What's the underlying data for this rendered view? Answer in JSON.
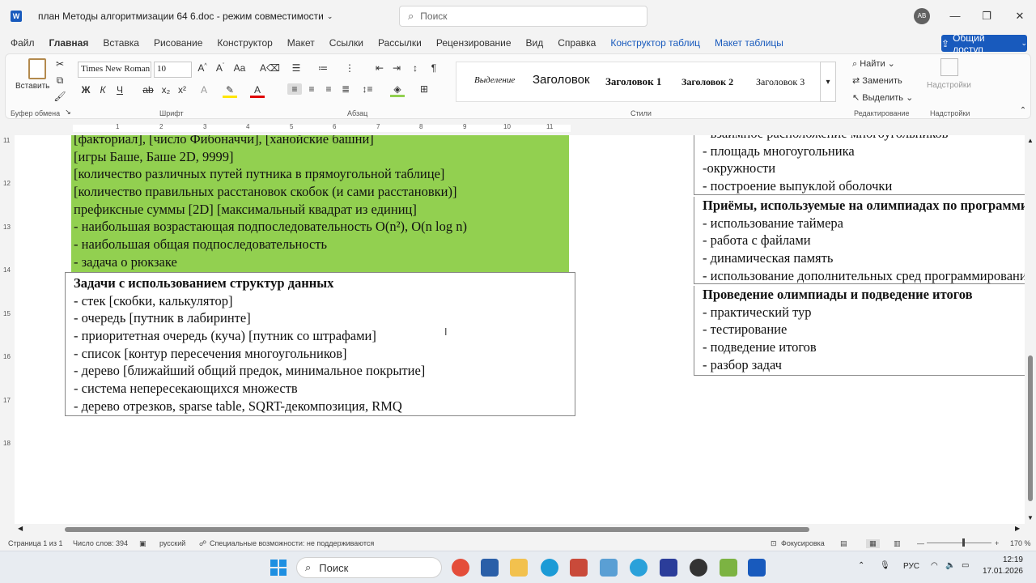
{
  "window": {
    "title": "план Методы алгоритмизации 64 6.doc  -  режим совместимости",
    "search_placeholder": "Поиск",
    "user_initials": "АВ"
  },
  "menu": [
    "Файл",
    "Главная",
    "Вставка",
    "Рисование",
    "Конструктор",
    "Макет",
    "Ссылки",
    "Рассылки",
    "Рецензирование",
    "Вид",
    "Справка",
    "Конструктор таблиц",
    "Макет таблицы"
  ],
  "share_label": "Общий доступ",
  "ribbon": {
    "paste_label": "Вставить",
    "font_name": "Times New Roman",
    "font_size": "10",
    "groups": {
      "clipboard": "Буфер обмена",
      "font": "Шрифт",
      "paragraph": "Абзац",
      "styles": "Стили",
      "editing": "Редактирование",
      "addins": "Надстройки"
    },
    "styles": [
      "Выделение",
      "Заголовок",
      "Заголовок 1",
      "Заголовок 2",
      "Заголовок 3"
    ],
    "editing": [
      "Найти",
      "Заменить",
      "Выделить"
    ],
    "addins_label": "Надстройки"
  },
  "ruler": {
    "h_ticks": [
      "1",
      "2",
      "3",
      "4",
      "5",
      "6",
      "7",
      "8",
      "9",
      "10",
      "11"
    ],
    "v_ticks": [
      "11",
      "12",
      "13",
      "14",
      "15",
      "16",
      "17",
      "18"
    ]
  },
  "document": {
    "left_green_cell": [
      "[факториал], [число Фибоначчи], [ханойские башни]",
      "[игры Баше, Баше 2D, 9999]",
      "[количество различных путей путника в прямоугольной таблице]",
      "[количество правильных расстановок скобок (и сами расстановки)]",
      "префиксные суммы [2D] [максимальный квадрат из единиц]",
      "- наибольшая возрастающая подпоследовательность O(n²), O(n log n)",
      "- наибольшая общая подпоследовательность",
      "- задача о рюкзаке"
    ],
    "left_cell2_title": "Задачи с использованием структур данных",
    "left_cell2": [
      "- стек [скобки, калькулятор]",
      "- очередь [путник в лабиринте]",
      "- приоритетная очередь (куча) [путник со штрафами]",
      "- список [контур пересечения многоугольников]",
      "- дерево [ближайший общий предок, минимальное покрытие]",
      "- система непересекающихся множеств",
      "- дерево отрезков, sparse table, SQRT-декомпозиция, RMQ"
    ],
    "right_cell1": [
      "- взаимное расположение многоугольников",
      "- площадь многоугольника",
      "-окружности",
      "- построение выпуклой оболочки"
    ],
    "right_cell2_title": "Приёмы, используемые на олимпиадах по программированию",
    "right_cell2": [
      "- использование таймера",
      "- работа с файлами",
      "- динамическая память",
      "- использование дополнительных сред программирования"
    ],
    "right_cell3_title": "Проведение олимпиады и подведение итогов",
    "right_cell3": [
      "- практический тур",
      "- тестирование",
      "- подведение итогов",
      "- разбор задач"
    ]
  },
  "status": {
    "page": "Страница 1 из 1",
    "words": "Число слов: 394",
    "language": "русский",
    "accessibility": "Специальные возможности: не поддерживаются",
    "focus": "Фокусировка",
    "zoom": "170 %"
  },
  "taskbar": {
    "search": "Поиск",
    "lang": "РУС",
    "time": "12:19",
    "date": "17.01.2026"
  },
  "colors": {
    "accent": "#185abd",
    "highlight_green": "#92d050"
  }
}
